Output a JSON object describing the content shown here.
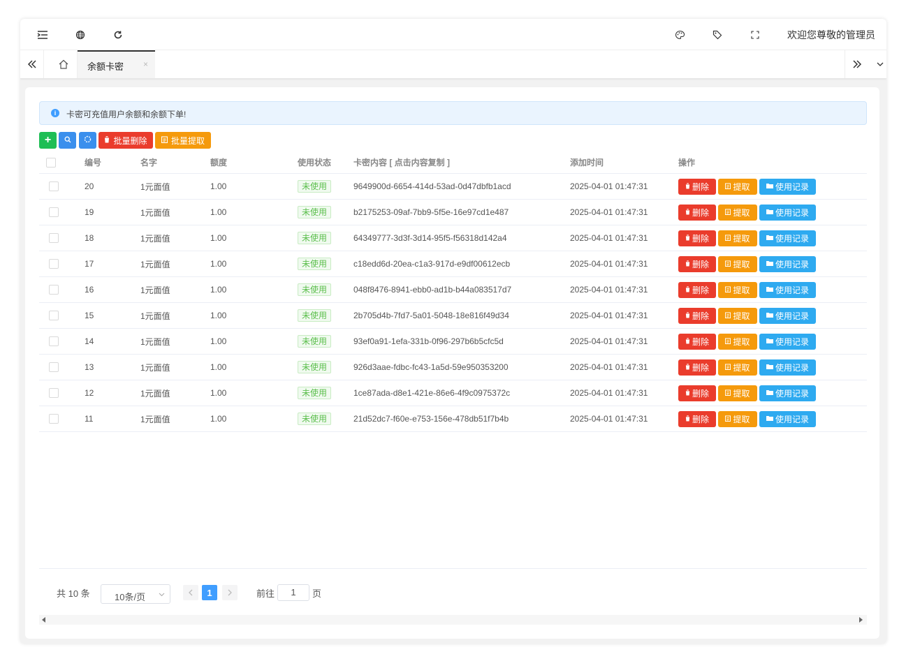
{
  "header": {
    "welcome": "欢迎您尊敬的管理员"
  },
  "tabs": {
    "active_label": "余额卡密",
    "close_glyph": "×"
  },
  "alert": {
    "text": "卡密可充值用户余额和余额下单!"
  },
  "toolbar": {
    "add_glyph": "+",
    "batch_delete": "批量删除",
    "batch_extract": "批量提取"
  },
  "table": {
    "columns": {
      "id": "编号",
      "name": "名字",
      "amount": "额度",
      "status": "使用状态",
      "content": "卡密内容 [ 点击内容复制 ]",
      "time": "添加时间",
      "actions": "操作"
    },
    "rows": [
      {
        "id": "20",
        "name": "1元面值",
        "amount": "1.00",
        "status": "未使用",
        "content": "9649900d-6654-414d-53ad-0d47dbfb1acd",
        "time": "2025-04-01 01:47:31"
      },
      {
        "id": "19",
        "name": "1元面值",
        "amount": "1.00",
        "status": "未使用",
        "content": "b2175253-09af-7bb9-5f5e-16e97cd1e487",
        "time": "2025-04-01 01:47:31"
      },
      {
        "id": "18",
        "name": "1元面值",
        "amount": "1.00",
        "status": "未使用",
        "content": "64349777-3d3f-3d14-95f5-f56318d142a4",
        "time": "2025-04-01 01:47:31"
      },
      {
        "id": "17",
        "name": "1元面值",
        "amount": "1.00",
        "status": "未使用",
        "content": "c18edd6d-20ea-c1a3-917d-e9df00612ecb",
        "time": "2025-04-01 01:47:31"
      },
      {
        "id": "16",
        "name": "1元面值",
        "amount": "1.00",
        "status": "未使用",
        "content": "048f8476-8941-ebb0-ad1b-b44a083517d7",
        "time": "2025-04-01 01:47:31"
      },
      {
        "id": "15",
        "name": "1元面值",
        "amount": "1.00",
        "status": "未使用",
        "content": "2b705d4b-7fd7-5a01-5048-18e816f49d34",
        "time": "2025-04-01 01:47:31"
      },
      {
        "id": "14",
        "name": "1元面值",
        "amount": "1.00",
        "status": "未使用",
        "content": "93ef0a91-1efa-331b-0f96-297b6b5cfc5d",
        "time": "2025-04-01 01:47:31"
      },
      {
        "id": "13",
        "name": "1元面值",
        "amount": "1.00",
        "status": "未使用",
        "content": "926d3aae-fdbc-fc43-1a5d-59e950353200",
        "time": "2025-04-01 01:47:31"
      },
      {
        "id": "12",
        "name": "1元面值",
        "amount": "1.00",
        "status": "未使用",
        "content": "1ce87ada-d8e1-421e-86e6-4f9c0975372c",
        "time": "2025-04-01 01:47:31"
      },
      {
        "id": "11",
        "name": "1元面值",
        "amount": "1.00",
        "status": "未使用",
        "content": "21d52dc7-f60e-e753-156e-478db51f7b4b",
        "time": "2025-04-01 01:47:31"
      }
    ],
    "actions": {
      "delete": "删除",
      "extract": "提取",
      "records": "使用记录"
    }
  },
  "pagination": {
    "total": "共 10 条",
    "page_size": "10条/页",
    "current_page": "1",
    "goto_label": "前往",
    "goto_value": "1",
    "page_unit": "页"
  },
  "colors": {
    "green": "#1ebe55",
    "blue": "#3a8fed",
    "red": "#ea3c2c",
    "orange": "#f59a0c",
    "cyan": "#2eaaf0",
    "primary": "#409eff"
  }
}
